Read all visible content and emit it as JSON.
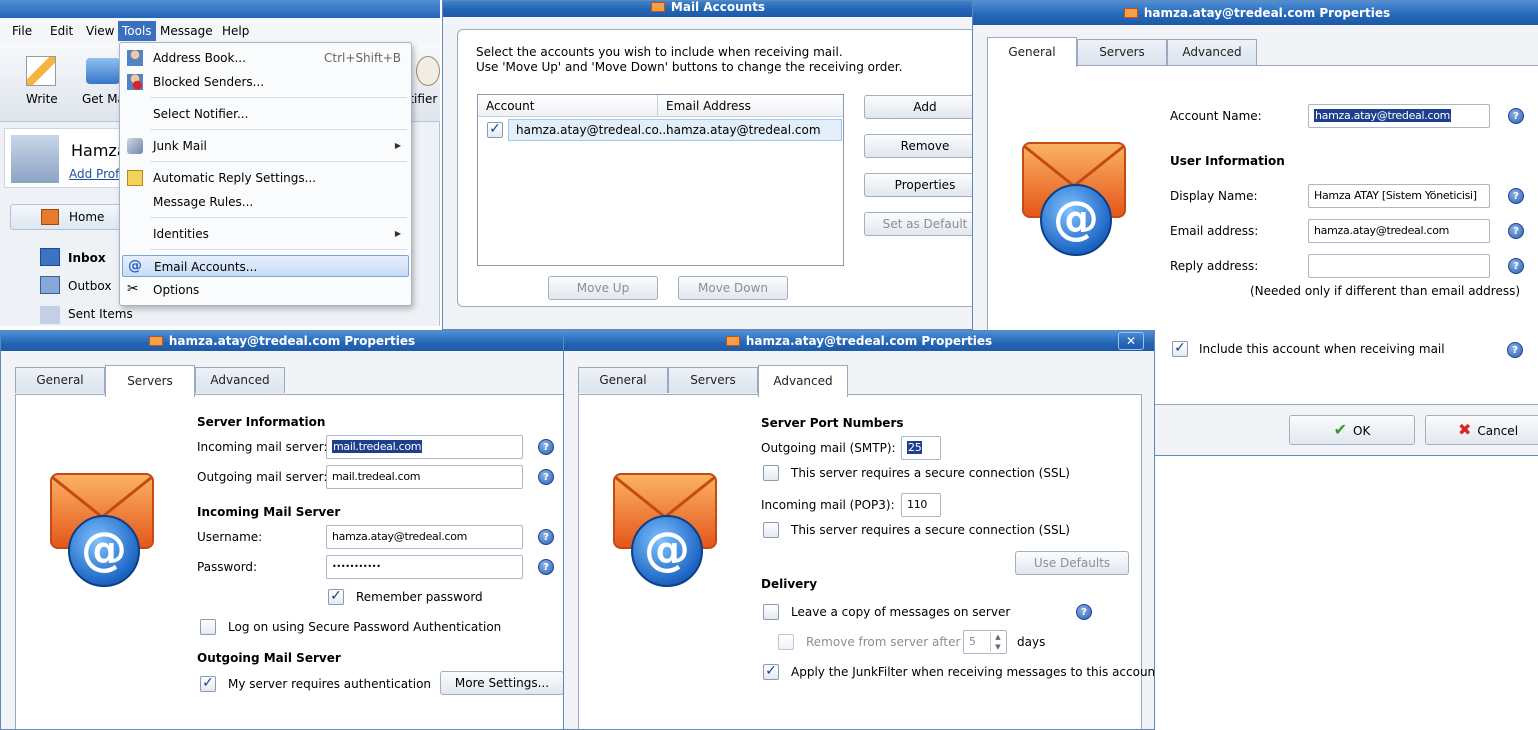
{
  "main_app": {
    "menubar": [
      "File",
      "Edit",
      "View",
      "Tools",
      "Message",
      "Help"
    ],
    "toolbar": {
      "write": "Write",
      "get_mail": "Get Ma",
      "notifier": "otifier"
    },
    "profile": {
      "name": "Hamza",
      "add_profile": "Add Profi"
    },
    "nav": {
      "home": "Home",
      "inbox": "Inbox",
      "outbox": "Outbox",
      "sent": "Sent Items"
    }
  },
  "tools_menu": {
    "items": [
      {
        "label": "Address Book...",
        "shortcut": "Ctrl+Shift+B",
        "icon": "address-book-icon"
      },
      {
        "label": "Blocked Senders...",
        "icon": "blocked-senders-icon"
      },
      {
        "label": "Select Notifier...",
        "icon": ""
      },
      {
        "label": "Junk Mail",
        "icon": "junk-mail-icon",
        "submenu": true
      },
      {
        "label": "Automatic Reply Settings...",
        "icon": "auto-reply-icon"
      },
      {
        "label": "Message Rules...",
        "icon": ""
      },
      {
        "label": "Identities",
        "icon": "",
        "submenu": true
      },
      {
        "label": "Email Accounts...",
        "icon": "at-icon",
        "highlighted": true
      },
      {
        "label": "Options",
        "icon": "tools-icon"
      }
    ]
  },
  "mail_accounts": {
    "title": "Mail Accounts",
    "instructions_1": "Select the accounts you wish to include when receiving mail.",
    "instructions_2": "Use 'Move Up' and 'Move Down' buttons to change the receiving order.",
    "columns": [
      "Account",
      "Email Address"
    ],
    "rows": [
      {
        "checked": true,
        "account": "hamza.atay@tredeal.co...",
        "email": "hamza.atay@tredeal.com"
      }
    ],
    "buttons": {
      "add": "Add",
      "remove": "Remove",
      "properties": "Properties",
      "set_default": "Set as Default",
      "move_up": "Move Up",
      "move_down": "Move Down"
    }
  },
  "props_general": {
    "title": "hamza.atay@tredeal.com Properties",
    "tabs": [
      "General",
      "Servers",
      "Advanced"
    ],
    "account_name_label": "Account Name:",
    "account_name": "hamza.atay@tredeal.com",
    "user_info_heading": "User Information",
    "display_name_label": "Display Name:",
    "display_name": "Hamza ATAY [Sistem Yöneticisi]",
    "email_label": "Email address:",
    "email": "hamza.atay@tredeal.com",
    "reply_label": "Reply address:",
    "reply": "",
    "reply_note": "(Needed only if different than email address)",
    "include_label": "Include this account when receiving mail",
    "ok": "OK",
    "cancel": "Cancel"
  },
  "props_servers": {
    "title": "hamza.atay@tredeal.com Properties",
    "tabs": [
      "General",
      "Servers",
      "Advanced"
    ],
    "server_info_heading": "Server Information",
    "incoming_label": "Incoming mail server:",
    "incoming": "mail.tredeal.com",
    "outgoing_label": "Outgoing mail server:",
    "outgoing": "mail.tredeal.com",
    "incoming_heading": "Incoming Mail Server",
    "username_label": "Username:",
    "username": "hamza.atay@tredeal.com",
    "password_label": "Password:",
    "password": "•••••••••••",
    "remember_label": "Remember password",
    "spa_label": "Log on using Secure Password Authentication",
    "outgoing_heading": "Outgoing Mail Server",
    "auth_label": "My server requires authentication",
    "more_settings": "More Settings..."
  },
  "props_advanced": {
    "title": "hamza.atay@tredeal.com Properties",
    "tabs": [
      "General",
      "Servers",
      "Advanced"
    ],
    "ports_heading": "Server Port Numbers",
    "smtp_label": "Outgoing mail (SMTP):",
    "smtp_port": "25",
    "ssl_label_1": "This server requires a secure connection (SSL)",
    "pop3_label": "Incoming mail (POP3):",
    "pop3_port": "110",
    "ssl_label_2": "This server requires a secure connection (SSL)",
    "use_defaults": "Use Defaults",
    "delivery_heading": "Delivery",
    "leave_copy_label": "Leave a copy of messages on server",
    "remove_after_label": "Remove from server after",
    "remove_days": "5",
    "days_label": "days",
    "junkfilter_label": "Apply the JunkFilter when receiving messages to this account"
  },
  "colors": {
    "title_bar": "#2466b6",
    "selection": "#1d3f8c",
    "accent": "#3c7fd0"
  }
}
